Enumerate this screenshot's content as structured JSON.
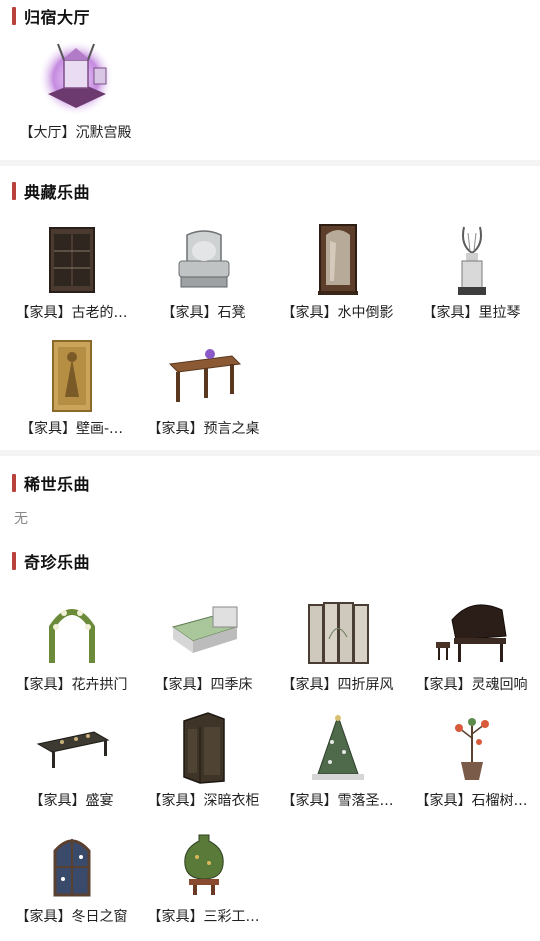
{
  "sections": {
    "hall": {
      "title": "归宿大厅",
      "items": [
        {
          "label": "【大厅】沉默宫殿",
          "icon": "palace-hall-icon"
        }
      ]
    },
    "collection": {
      "title": "典藏乐曲",
      "items": [
        {
          "label": "【家具】古老的…",
          "icon": "old-cabinet-icon"
        },
        {
          "label": "【家具】石凳",
          "icon": "stone-chair-icon"
        },
        {
          "label": "【家具】水中倒影",
          "icon": "mirror-icon"
        },
        {
          "label": "【家具】里拉琴",
          "icon": "lyre-icon"
        },
        {
          "label": "【家具】壁画-…",
          "icon": "mural-icon"
        },
        {
          "label": "【家具】预言之桌",
          "icon": "prophecy-table-icon"
        }
      ]
    },
    "rare": {
      "title": "稀世乐曲",
      "empty": "无"
    },
    "treasure": {
      "title": "奇珍乐曲",
      "items": [
        {
          "label": "【家具】花卉拱门",
          "icon": "flower-arch-icon"
        },
        {
          "label": "【家具】四季床",
          "icon": "bed-icon"
        },
        {
          "label": "【家具】四折屏风",
          "icon": "folding-screen-icon"
        },
        {
          "label": "【家具】灵魂回响",
          "icon": "piano-icon"
        },
        {
          "label": "【家具】盛宴",
          "icon": "banquet-table-icon"
        },
        {
          "label": "【家具】深暗衣柜",
          "icon": "wardrobe-icon"
        },
        {
          "label": "【家具】雪落圣…",
          "icon": "christmas-tree-icon"
        },
        {
          "label": "【家具】石榴树…",
          "icon": "pomegranate-tree-icon"
        },
        {
          "label": "【家具】冬日之窗",
          "icon": "winter-window-icon"
        },
        {
          "label": "【家具】三彩工…",
          "icon": "tricolor-vase-icon"
        }
      ]
    }
  }
}
